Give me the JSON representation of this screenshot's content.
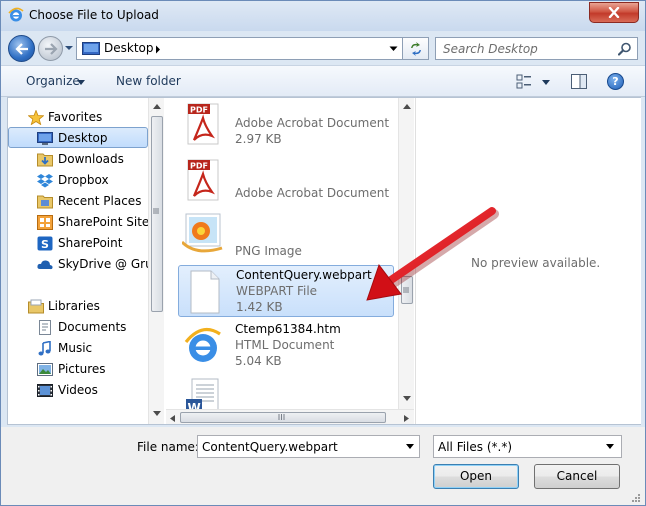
{
  "window": {
    "title": "Choose File to Upload"
  },
  "address": {
    "location": "Desktop",
    "search_placeholder": "Search Desktop"
  },
  "toolbar": {
    "organize": "Organize",
    "new_folder": "New folder"
  },
  "nav": {
    "favorites": "Favorites",
    "items_fav": [
      "Desktop",
      "Downloads",
      "Dropbox",
      "Recent Places",
      "SharePoint Sites",
      "SharePoint",
      "SkyDrive @ Grup"
    ],
    "libraries": "Libraries",
    "items_lib": [
      "Documents",
      "Music",
      "Pictures",
      "Videos"
    ],
    "selected": "Desktop"
  },
  "files": [
    {
      "type": "Adobe Acrobat Document",
      "size": "2.97 KB",
      "icon": "pdf-icon"
    },
    {
      "type": "Adobe Acrobat Document",
      "icon": "pdf-icon"
    },
    {
      "type": "PNG Image",
      "icon": "png-image-icon"
    },
    {
      "name": "ContentQuery.webpart",
      "type": "WEBPART File",
      "size": "1.42 KB",
      "icon": "generic-file-icon",
      "selected": true
    },
    {
      "name": "Ctemp61384.htm",
      "type": "HTML Document",
      "size": "5.04 KB",
      "icon": "internet-explorer-icon"
    }
  ],
  "preview": {
    "message": "No preview available."
  },
  "footer": {
    "file_name_label": "File name:",
    "file_name_value": "ContentQuery.webpart",
    "file_type": "All Files (*.*)",
    "open": "Open",
    "cancel": "Cancel"
  },
  "colors": {
    "annotation_arrow": "#e8141b",
    "selection": "#c9e0fb"
  }
}
